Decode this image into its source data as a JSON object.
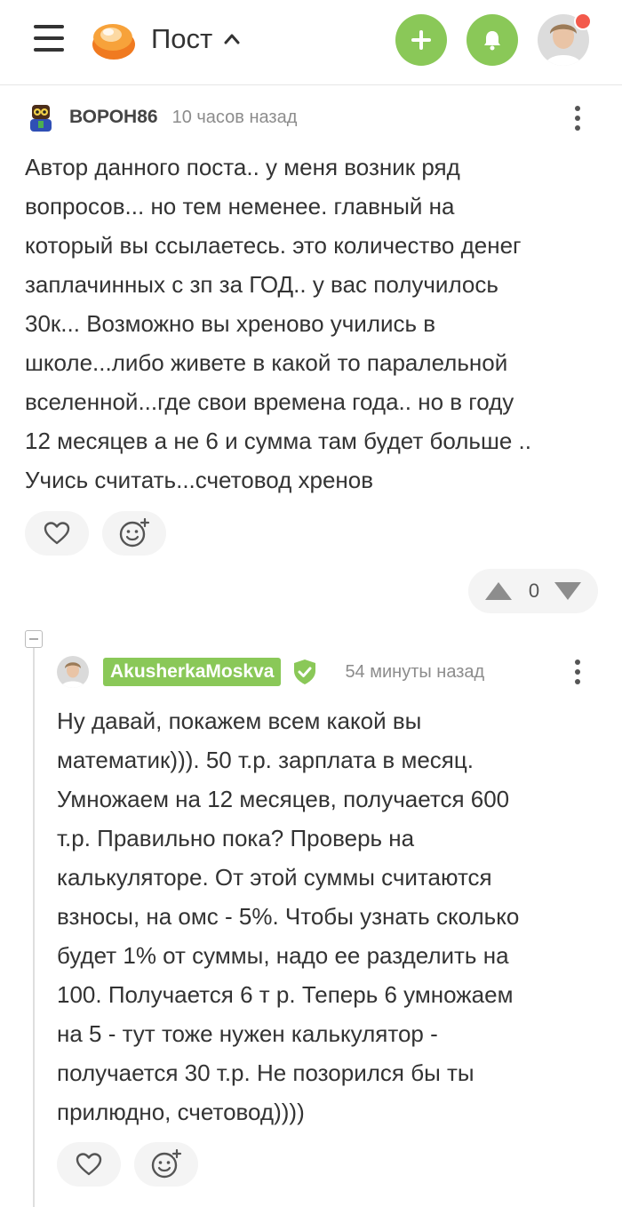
{
  "header": {
    "title": "Пост",
    "menu_icon": "hamburger-icon",
    "logo": "pikabu-logo",
    "add_icon": "plus-icon",
    "bell_icon": "bell-icon",
    "accent_color": "#8ac858",
    "notification_color": "#f3594b"
  },
  "comments": [
    {
      "author": "ВОРОН86",
      "time": "10 часов назад",
      "text": "Автор данного поста.. у меня возник ряд\nвопросов... но тем неменее. главный на\nкоторый вы ссылаетесь. это количество денег\nзаплачинных с зп за ГОД.. у вас получилось\n30к... Возможно вы хреново учились в\nшколе...либо живете в какой то паралельной\nвселенной...где свои времена года.. но в году\n12 месяцев а не 6 и сумма там будет больше ..\nУчись считать...счетовод хренов",
      "rating": "0"
    },
    {
      "author": "AkusherkaMoskva",
      "time": "54 минуты назад",
      "verified_icon": "shield-check-icon",
      "text": "Ну давай, покажем всем какой вы\nматематик))). 50 т.р. зарплата в месяц.\nУмножаем на 12 месяцев, получается 600\nт.р. Правильно пока? Проверь на\nкалькуляторе. От этой суммы считаются\nвзносы, на омс - 5%. Чтобы узнать сколько\nбудет 1% от суммы, надо ее разделить на\n100. Получается 6 т р. Теперь 6 умножаем\nна 5 - тут тоже нужен калькулятор -\nполучается 30 т.р. Не позорился бы ты\nприлюдно, счетовод))))"
    }
  ]
}
